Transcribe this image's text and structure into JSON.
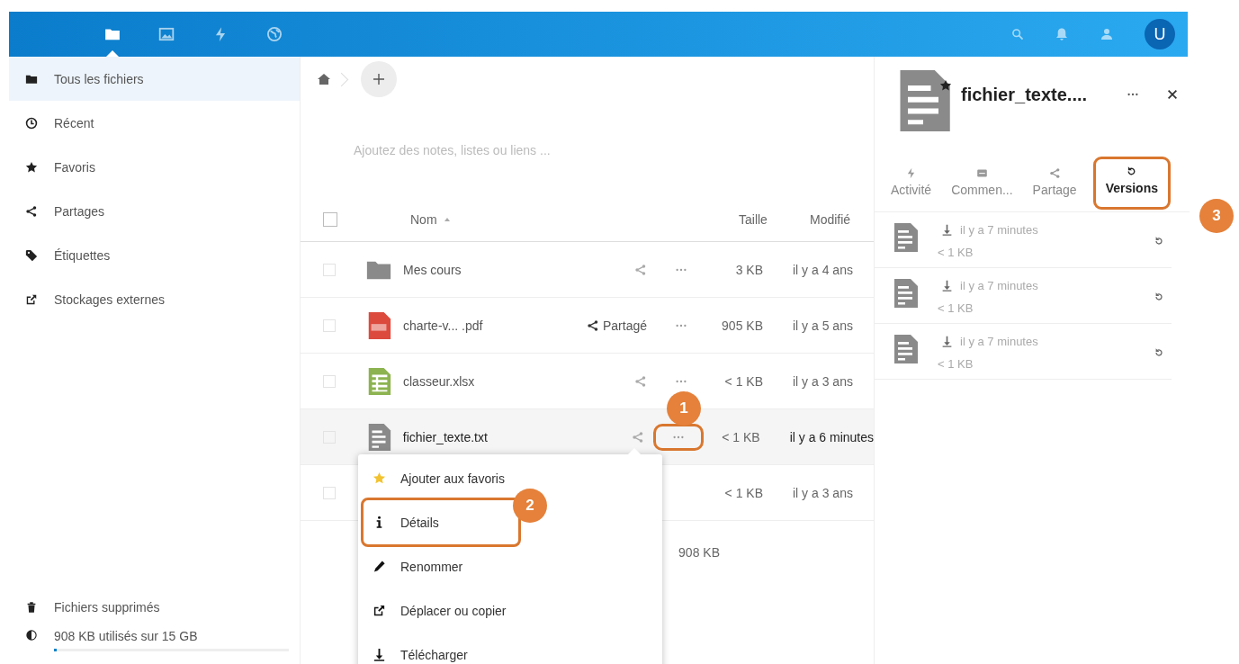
{
  "header": {
    "apps": [
      {
        "kind": "folder",
        "selected": true
      },
      {
        "kind": "image",
        "selected": false
      },
      {
        "kind": "bolt",
        "selected": false
      },
      {
        "kind": "globe",
        "selected": false
      }
    ],
    "avatar": "U"
  },
  "sidebar": {
    "items": [
      {
        "kind": "folder",
        "label": "Tous les fichiers",
        "selected": true
      },
      {
        "kind": "clock",
        "label": "Récent",
        "selected": false
      },
      {
        "kind": "star",
        "label": "Favoris",
        "selected": false
      },
      {
        "kind": "share",
        "label": "Partages",
        "selected": false
      },
      {
        "kind": "tag",
        "label": "Étiquettes",
        "selected": false
      },
      {
        "kind": "external",
        "label": "Stockages externes",
        "selected": false
      }
    ],
    "footer": [
      {
        "kind": "trash",
        "label": "Fichiers supprimés"
      }
    ],
    "quota": {
      "label": "908 KB utilisés sur 15 GB",
      "level": 0.01
    }
  },
  "files": {
    "notes_placeholder": "Ajoutez des notes, listes ou liens ...",
    "columns": {
      "name": "Nom",
      "size": "Taille",
      "modified": "Modifié",
      "all_checked": false
    },
    "rows": [
      {
        "kind": "folder",
        "name": "Mes cours",
        "size": "3 KB",
        "modified": "il y a 4 ans",
        "checked": false,
        "highlighted": false
      },
      {
        "kind": "pdf",
        "name": "charte-v... .pdf",
        "share_label": "Partagé",
        "size": "905 KB",
        "modified": "il y a 5 ans",
        "checked": false,
        "highlighted": false
      },
      {
        "kind": "sheet",
        "name": "classeur.xlsx",
        "size": "< 1 KB",
        "modified": "il y a 3 ans",
        "checked": false,
        "highlighted": false
      },
      {
        "kind": "text",
        "name": "fichier_texte.txt",
        "size": "< 1 KB",
        "modified": "il y a 6 minutes",
        "checked": false,
        "highlighted": true,
        "callout": "1"
      },
      {
        "size": "< 1 KB",
        "modified": "il y a 3 ans",
        "checked": false,
        "highlighted": false
      }
    ],
    "total_size": "908 KB",
    "menu": [
      {
        "kind": "star",
        "label": "Ajouter aux favoris"
      },
      {
        "kind": "info",
        "label": "Détails",
        "callout": "2"
      },
      {
        "kind": "pencil",
        "label": "Renommer"
      },
      {
        "kind": "external",
        "label": "Déplacer ou copier"
      },
      {
        "kind": "download",
        "label": "Télécharger"
      }
    ]
  },
  "details": {
    "title": "fichier_texte....",
    "favorite": true,
    "tabs": [
      {
        "kind": "bolt",
        "label": "Activité",
        "selected": false
      },
      {
        "kind": "comment",
        "label": "Commen...",
        "selected": false
      },
      {
        "kind": "share",
        "label": "Partage",
        "selected": false
      },
      {
        "kind": "restore",
        "label": "Versions",
        "selected": true,
        "callout": "3"
      }
    ],
    "versions": [
      {
        "time": "il y a 7 minutes",
        "size": "< 1 KB"
      },
      {
        "time": "il y a 7 minutes",
        "size": "< 1 KB"
      },
      {
        "time": "il y a 7 minutes",
        "size": "< 1 KB"
      }
    ]
  }
}
